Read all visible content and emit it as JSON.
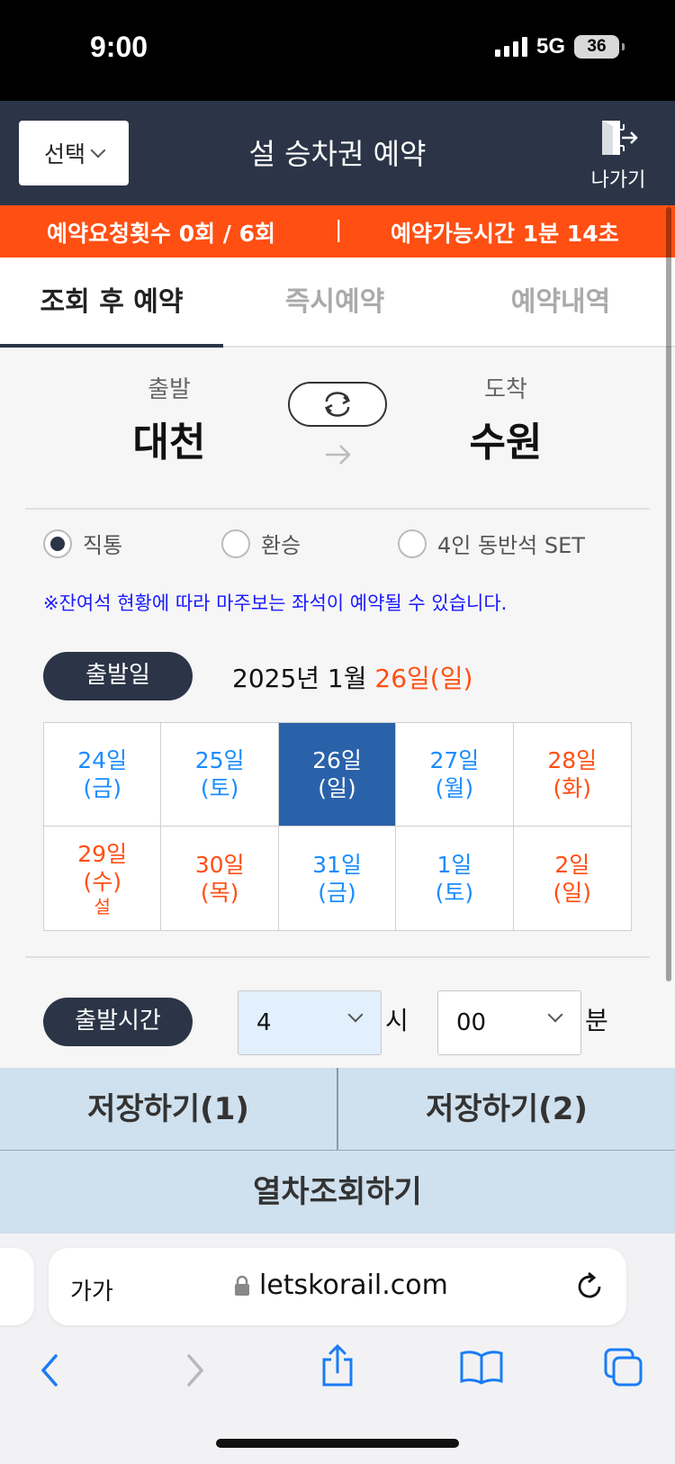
{
  "status": {
    "time": "9:00",
    "network": "5G",
    "battery": "36"
  },
  "header": {
    "select_label": "선택",
    "title": "설 승차권 예약",
    "exit_label": "나가기"
  },
  "banner": {
    "requests": "예약요청횟수 0회 / 6회",
    "separator": "|",
    "time_left": "예약가능시간 1분 14초"
  },
  "tabs": [
    {
      "label": "조회 후 예약",
      "active": true
    },
    {
      "label": "즉시예약",
      "active": false
    },
    {
      "label": "예약내역",
      "active": false
    }
  ],
  "route": {
    "departure_caption": "출발",
    "departure": "대천",
    "arrival_caption": "도착",
    "arrival": "수원"
  },
  "trip_types": [
    {
      "label": "직통",
      "checked": true
    },
    {
      "label": "환승",
      "checked": false
    },
    {
      "label": "4인 동반석 SET",
      "checked": false
    }
  ],
  "notice": "※잔여석 현황에 따라 마주보는 좌석이 예약될 수 있습니다.",
  "date": {
    "label": "출발일",
    "prefix": "2025년 1월 ",
    "selected": "26일(일)",
    "cells": [
      {
        "day": "24일",
        "weekday": "(금)",
        "holiday": "",
        "color": "blue",
        "selected": false
      },
      {
        "day": "25일",
        "weekday": "(토)",
        "holiday": "",
        "color": "blue",
        "selected": false
      },
      {
        "day": "26일",
        "weekday": "(일)",
        "holiday": "",
        "color": "blue",
        "selected": true
      },
      {
        "day": "27일",
        "weekday": "(월)",
        "holiday": "",
        "color": "blue",
        "selected": false
      },
      {
        "day": "28일",
        "weekday": "(화)",
        "holiday": "",
        "color": "red",
        "selected": false
      },
      {
        "day": "29일",
        "weekday": "(수)",
        "holiday": "설",
        "color": "red",
        "selected": false
      },
      {
        "day": "30일",
        "weekday": "(목)",
        "holiday": "",
        "color": "red",
        "selected": false
      },
      {
        "day": "31일",
        "weekday": "(금)",
        "holiday": "",
        "color": "blue",
        "selected": false
      },
      {
        "day": "1일",
        "weekday": "(토)",
        "holiday": "",
        "color": "blue",
        "selected": false
      },
      {
        "day": "2일",
        "weekday": "(일)",
        "holiday": "",
        "color": "red",
        "selected": false
      }
    ]
  },
  "time": {
    "label": "출발시간",
    "hour": "4",
    "hour_unit": "시",
    "minute": "00",
    "minute_unit": "분"
  },
  "actions": {
    "save1": "저장하기(1)",
    "save2": "저장하기(2)",
    "search": "열차조회하기"
  },
  "browser": {
    "aa": "가가",
    "url": "letskorail.com"
  },
  "colors": {
    "navy": "#2b3547",
    "orange": "#ff4f13",
    "selected_blue": "#2a62aa",
    "weekday_blue": "#1a8cff",
    "button_bg": "#cfe0ee"
  },
  "icons": [
    "exit-icon",
    "swap-icon",
    "arrow-right-icon",
    "chevron-down-icon",
    "lock-icon",
    "reload-icon",
    "back-icon",
    "forward-icon",
    "share-icon",
    "bookmarks-icon",
    "tabs-icon"
  ]
}
